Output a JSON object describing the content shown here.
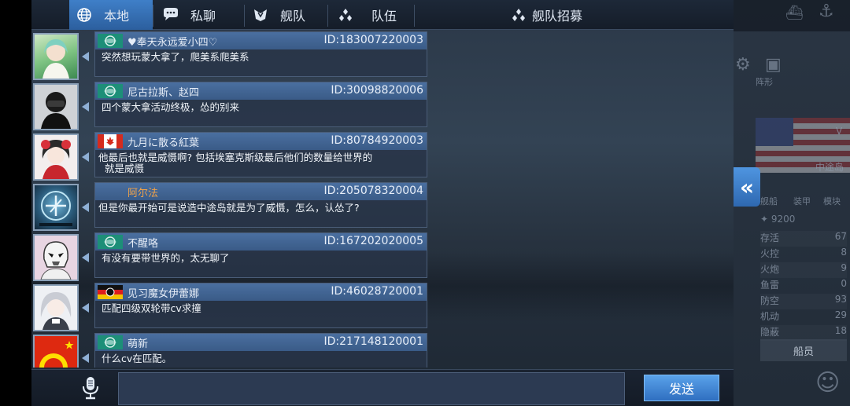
{
  "tabs": [
    {
      "label": "本地",
      "icon": "globe-icon",
      "active": true
    },
    {
      "label": "私聊",
      "icon": "chat-bubble-icon",
      "active": false
    },
    {
      "label": "舰队",
      "icon": "fleet-icon",
      "active": false
    },
    {
      "label": "队伍",
      "icon": "team-icon",
      "active": false
    },
    {
      "label": "舰队招募",
      "icon": "fleet-recruit-icon",
      "active": false
    }
  ],
  "messages": [
    {
      "name": "♥奉天永远爱小四♡",
      "id": "ID:183007220003",
      "text": "突然想玩蒙大拿了，爬美系爬美系",
      "flag": "emblem-flag-icon",
      "avatar": "avatar-anime-green"
    },
    {
      "name": "尼古拉斯、赵四",
      "id": "ID:30098820006",
      "text": "四个蒙大拿活动终极，怂的别来",
      "flag": "emblem-flag-icon",
      "avatar": "avatar-masked-person"
    },
    {
      "name": "九月に散る紅葉",
      "id": "ID:80784920003",
      "text": "他最后也就是威慑啊? 包括埃塞克斯级最后他们的数量给世界的",
      "text2": "就是威慑",
      "flag": "canada-flag-icon",
      "avatar": "avatar-anime-red"
    },
    {
      "name": "阿尔法",
      "id": "ID:205078320004",
      "text": "但是你最开始可是说造中途岛就是为了威慑，怎么，认怂了?",
      "flag": "",
      "avatar": "avatar-ship-emblem",
      "name_color": "orange"
    },
    {
      "name": "不醒咯",
      "id": "ID:167202020005",
      "text": "有没有要带世界的，太无聊了",
      "flag": "emblem-flag-icon",
      "avatar": "avatar-stormtrooper"
    },
    {
      "name": "见习魔女伊蕾娜",
      "id": "ID:46028720001",
      "text": "匹配四级双轮带cv求撞",
      "flag": "germany-flag-icon",
      "avatar": "avatar-anime-silver"
    },
    {
      "name": "萌新",
      "id": "ID:217148120001",
      "text": "什么cv在匹配。",
      "flag": "emblem-flag-icon",
      "avatar": "avatar-china-flag"
    }
  ],
  "input": {
    "value": "",
    "placeholder": ""
  },
  "send_label": "发送",
  "right_panel": {
    "power": "9200",
    "stats": [
      {
        "label": "存活",
        "value": "67"
      },
      {
        "label": "火控",
        "value": "8"
      },
      {
        "label": "火炮",
        "value": "9"
      },
      {
        "label": "鱼雷",
        "value": "0"
      },
      {
        "label": "防空",
        "value": "93"
      },
      {
        "label": "机动",
        "value": "29"
      },
      {
        "label": "隐蔽",
        "value": "18"
      }
    ],
    "crew_label": "船员",
    "ship_name": "中途岛",
    "tabs": [
      "舰船",
      "装甲",
      "模块"
    ],
    "tag": "V"
  },
  "colors": {
    "accent": "#3f7fc8",
    "send": "#2f6fc0",
    "name_orange": "#f0a24a"
  }
}
